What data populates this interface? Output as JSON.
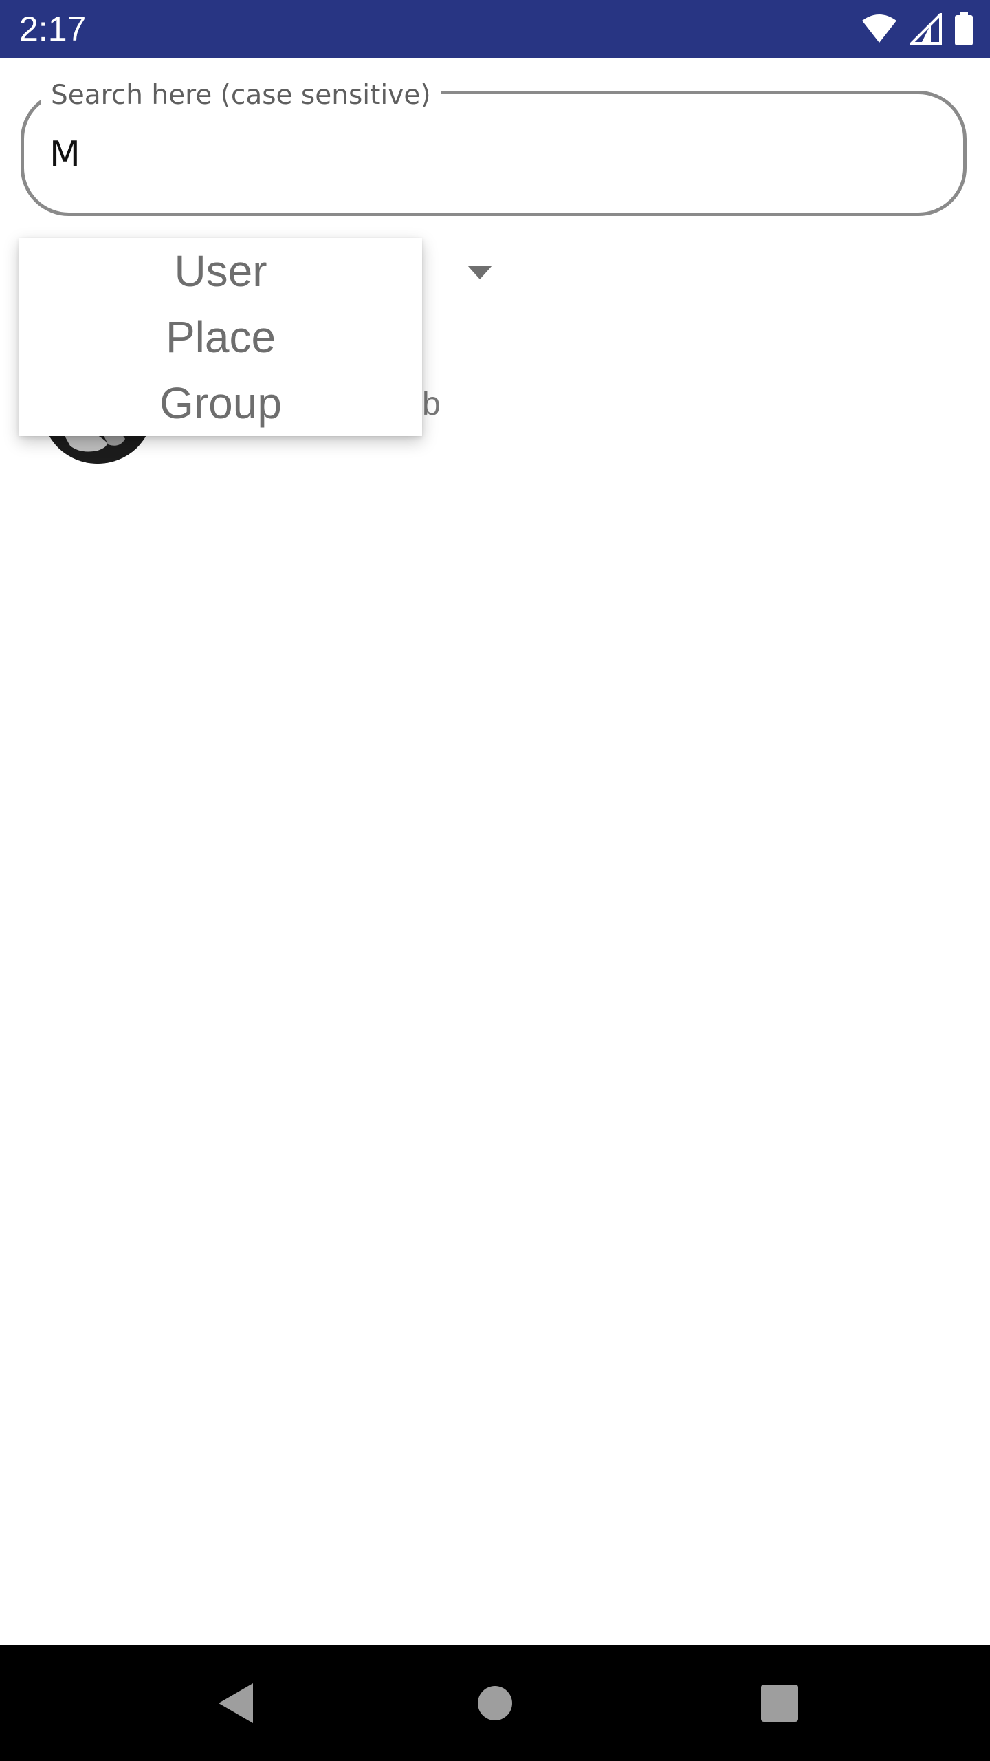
{
  "status_bar": {
    "time": "2:17",
    "background_color": "#283583",
    "icons": [
      "wifi-icon",
      "cellular-signal-icon",
      "battery-icon"
    ]
  },
  "search": {
    "label": "Search here (case sensitive)",
    "value": "M"
  },
  "filter_spinner": {
    "icon": "chevron-down-icon",
    "options": [
      "User",
      "Place",
      "Group"
    ]
  },
  "results": [
    {
      "visible_name_fragment": "tib",
      "avatar": "avatar"
    }
  ],
  "nav_bar": {
    "buttons": [
      "back-icon",
      "home-icon",
      "recents-icon"
    ]
  }
}
